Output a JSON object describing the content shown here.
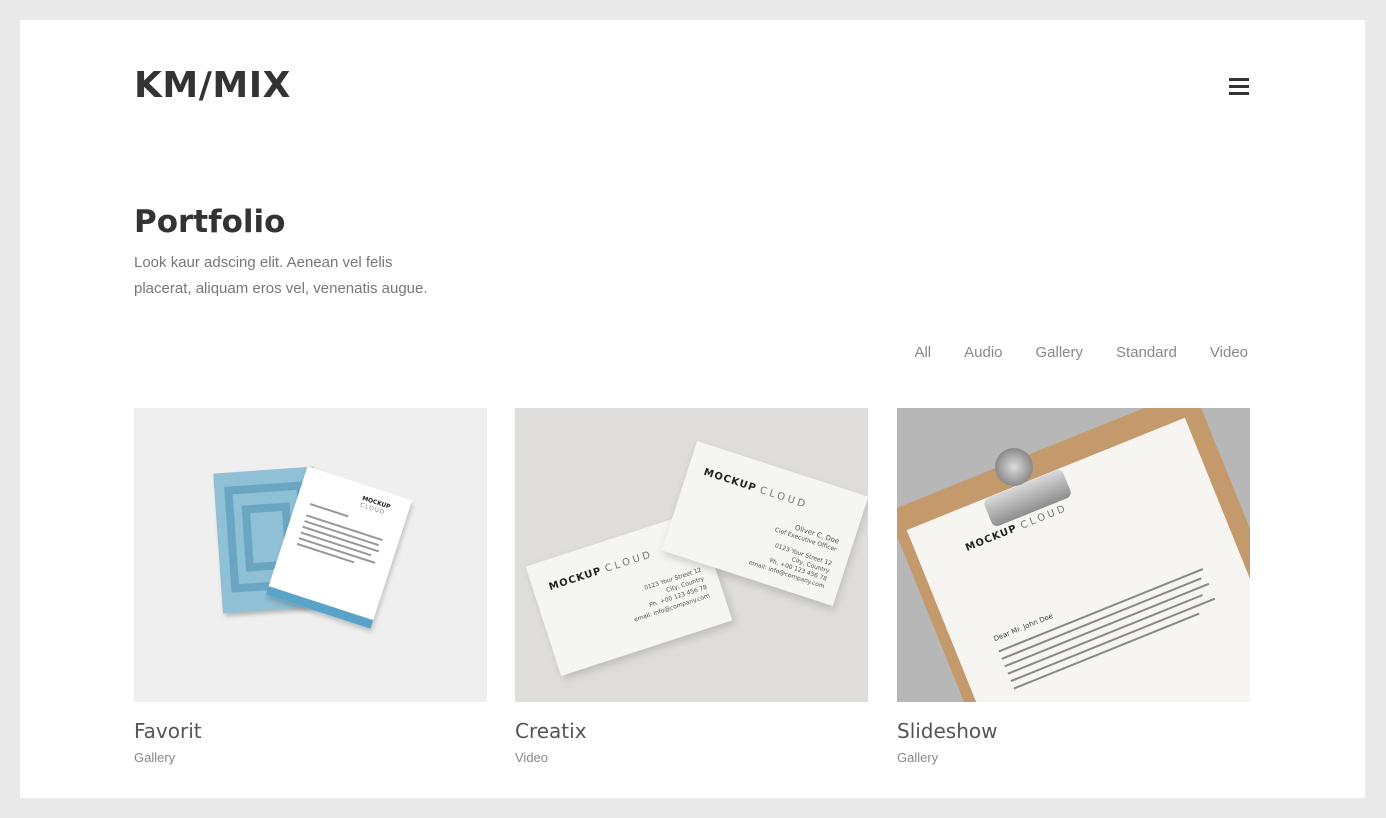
{
  "header": {
    "logo": "KM/MIX",
    "menu_icon": "hamburger-menu-icon"
  },
  "hero": {
    "title": "Portfolio",
    "intro_line1": "Look kaur adscing elit. Aenean vel felis",
    "intro_line2": "placerat, aliquam eros vel, venenatis augue."
  },
  "filters": [
    "All",
    "Audio",
    "Gallery",
    "Standard",
    "Video"
  ],
  "items": [
    {
      "title": "Favorit",
      "category": "Gallery",
      "thumb": {
        "brand_bold": "MOCKUP",
        "brand_thin": "CLOUD"
      }
    },
    {
      "title": "Creatix",
      "category": "Video",
      "thumb": {
        "brand_bold": "MOCKUP",
        "brand_thin": "CLOUD",
        "name": "Oliver C. Doe",
        "role": "Cief Executive Officer",
        "addr1": "0123 Your Street 12",
        "addr2": "City, Country",
        "phone": "Ph. +00 123 456 78",
        "email": "email: info@company.com"
      }
    },
    {
      "title": "Slideshow",
      "category": "Gallery",
      "thumb": {
        "brand_bold": "MOCKUP",
        "brand_thin": "CLOUD",
        "greeting": "Dear Mr. John Doe"
      }
    }
  ],
  "colors": {
    "background": "#e9e9e9",
    "surface": "#ffffff",
    "text_dark": "#333333",
    "text_muted": "#888888",
    "accent_blue": "#5aa3c8",
    "clipboard": "#c49a6c"
  }
}
